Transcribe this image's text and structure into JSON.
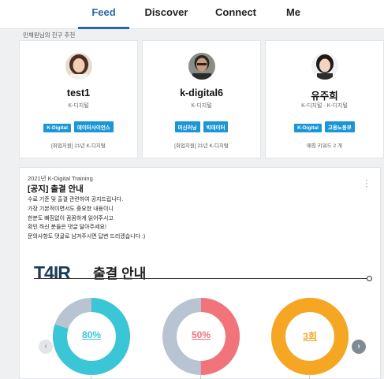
{
  "nav": {
    "tabs": [
      {
        "label": "Feed",
        "active": true
      },
      {
        "label": "Discover",
        "active": false
      },
      {
        "label": "Connect",
        "active": false
      },
      {
        "label": "Me",
        "active": false
      }
    ]
  },
  "recommend": {
    "label": "민채원님의 친구 추천",
    "cards": [
      {
        "name": "test1",
        "org": "K-디지털",
        "tags": [
          "K-Digital",
          "데이터사이언스"
        ],
        "footer": "[취업지원] 21년 K-디지털"
      },
      {
        "name": "k-digital6",
        "org": "K-디지털",
        "tags": [
          "머신러닝",
          "빅데이터"
        ],
        "footer": "[취업지원] 21년 K-디지털"
      },
      {
        "name": "유주희",
        "org": "K-디지털 · K-디지털",
        "tags": [
          "K-Digital",
          "고용노동부"
        ],
        "footer": "매칭 키워드 2 개"
      }
    ]
  },
  "notice": {
    "course": "2021년 K-Digital Training",
    "title": "[공지] 출결 안내",
    "lines": [
      "수료 기준 및 출결 관련하여 공지드립니다.",
      "가장 기본적이면서도 중요한 내용이니",
      "한분도 빠짐없이 꼼꼼하게 읽어주시고",
      "확인 하신 분들은 댓글 달아주세요!",
      "문의사항도 댓글로 남겨주시면 답변 드리겠습니다 :)"
    ],
    "banner": {
      "logo": "T4IR",
      "title": "출결 안내",
      "stats": [
        {
          "label": "80%",
          "fraction": 0.8,
          "color": "#3ac6d6",
          "track": "#b8c4d2"
        },
        {
          "label": "50%",
          "fraction": 0.5,
          "color": "#f0747a",
          "track": "#b8c4d2"
        },
        {
          "label": "3회",
          "fraction": 1.0,
          "color": "#f5a623",
          "track": "#f5a623"
        }
      ]
    }
  },
  "colors": {
    "accent": "#2767a8",
    "tag": "#1a96d6"
  }
}
